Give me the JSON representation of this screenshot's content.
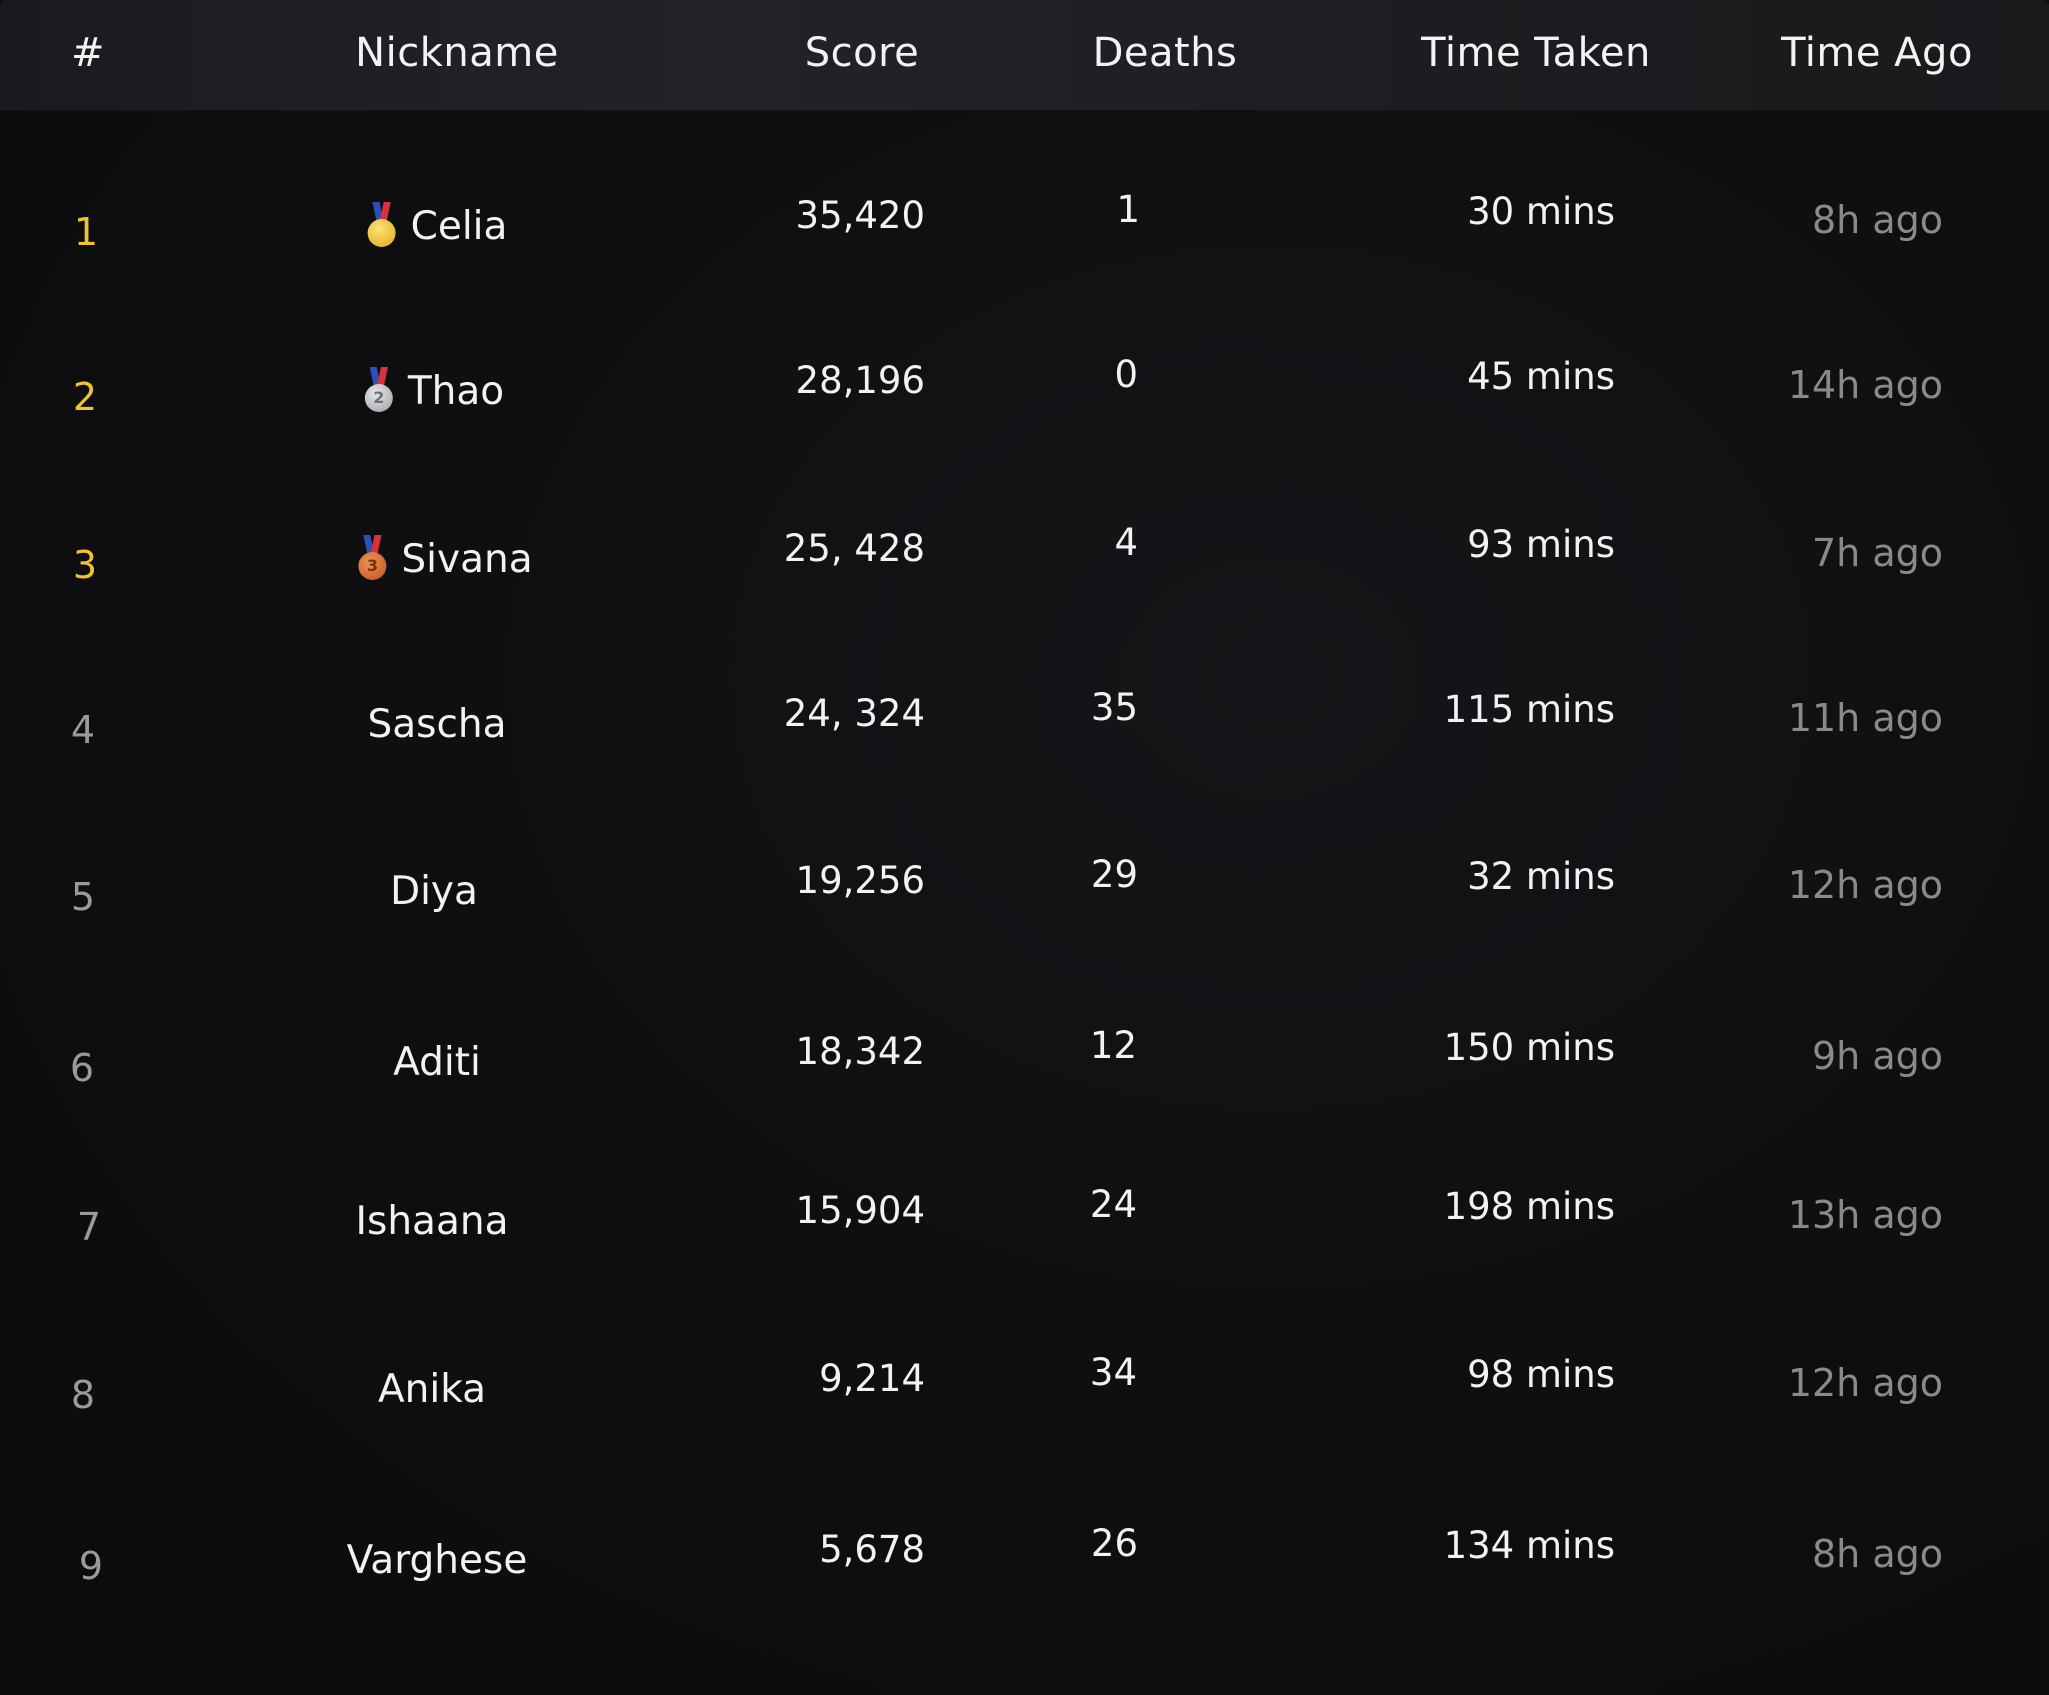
{
  "columns": {
    "rank": "#",
    "nickname": "Nickname",
    "score": "Score",
    "deaths": "Deaths",
    "time_taken": "Time Taken",
    "time_ago": "Time Ago"
  },
  "colors": {
    "top_rank": "#f2c230",
    "rank": "#9a9a9e",
    "text": "#f2f2f4",
    "muted": "#8a8a8e",
    "background": "#0c0c0e",
    "header": "#222228"
  },
  "rows": [
    {
      "rank": "1",
      "nickname": "Celia",
      "medal": "gold-medal-icon",
      "score": "35,420",
      "deaths": "1",
      "time_taken": "30 mins",
      "time_ago": "8h ago"
    },
    {
      "rank": "2",
      "nickname": "Thao",
      "medal": "silver-medal-icon",
      "score": "28,196",
      "deaths": "0",
      "time_taken": "45 mins",
      "time_ago": "14h ago"
    },
    {
      "rank": "3",
      "nickname": "Sivana",
      "medal": "bronze-medal-icon",
      "score": "25, 428",
      "deaths": "4",
      "time_taken": "93 mins",
      "time_ago": "7h ago"
    },
    {
      "rank": "4",
      "nickname": "Sascha",
      "score": "24, 324",
      "deaths": "35",
      "time_taken": "115 mins",
      "time_ago": "11h ago"
    },
    {
      "rank": "5",
      "nickname": "Diya",
      "score": "19,256",
      "deaths": "29",
      "time_taken": "32 mins",
      "time_ago": "12h ago"
    },
    {
      "rank": "6",
      "nickname": "Aditi",
      "score": "18,342",
      "deaths": "12",
      "time_taken": "150 mins",
      "time_ago": "9h ago"
    },
    {
      "rank": "7",
      "nickname": "Ishaana",
      "score": "15,904",
      "deaths": "24",
      "time_taken": "198 mins",
      "time_ago": "13h ago"
    },
    {
      "rank": "8",
      "nickname": "Anika",
      "score": "9,214",
      "deaths": "34",
      "time_taken": "98 mins",
      "time_ago": "12h ago"
    },
    {
      "rank": "9",
      "nickname": "Varghese",
      "score": "5,678",
      "deaths": "26",
      "time_taken": "134 mins",
      "time_ago": "8h ago"
    }
  ]
}
